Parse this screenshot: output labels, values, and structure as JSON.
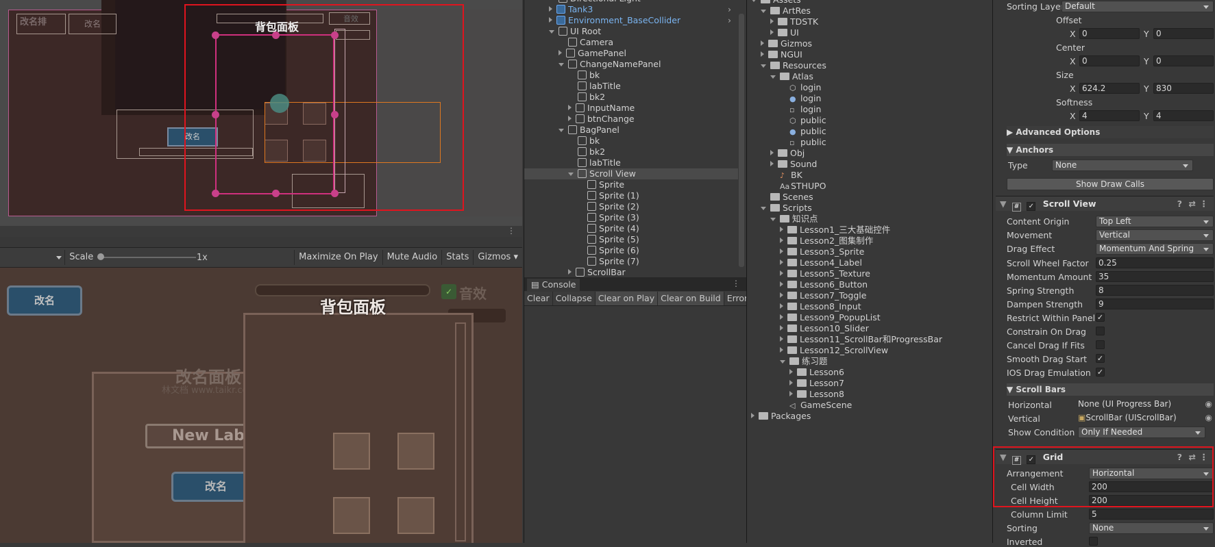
{
  "scene": {
    "title_label": "背包面板",
    "btn_rename_small": "改名",
    "top_left_label": "改名排",
    "top_btn": "改名",
    "top_right_label": "音效"
  },
  "game_toolbar": {
    "scale_label": "Scale",
    "scale_value": "1x",
    "maximize": "Maximize On Play",
    "mute": "Mute Audio",
    "stats": "Stats",
    "gizmos": "Gizmos"
  },
  "game": {
    "rename_btn": "改名",
    "bag_title": "背包面板",
    "sound_label": "音效",
    "rename_panel_title": "改名面板",
    "watermark": "林文档 www.taikr.com",
    "new_label": "New Label",
    "rename_btn2": "改名"
  },
  "hierarchy": {
    "items": [
      {
        "label": "Directional Light",
        "indent": 1
      },
      {
        "label": "Tank3",
        "indent": 1,
        "prefab": true
      },
      {
        "label": "Environment_BaseCollider",
        "indent": 1,
        "prefab": true
      },
      {
        "label": "UI Root",
        "indent": 1
      },
      {
        "label": "Camera",
        "indent": 2
      },
      {
        "label": "GamePanel",
        "indent": 2
      },
      {
        "label": "ChangeNamePanel",
        "indent": 2
      },
      {
        "label": "bk",
        "indent": 3
      },
      {
        "label": "labTitle",
        "indent": 3
      },
      {
        "label": "bk2",
        "indent": 3
      },
      {
        "label": "InputName",
        "indent": 3
      },
      {
        "label": "btnChange",
        "indent": 3
      },
      {
        "label": "BagPanel",
        "indent": 2
      },
      {
        "label": "bk",
        "indent": 3
      },
      {
        "label": "bk2",
        "indent": 3
      },
      {
        "label": "labTitle",
        "indent": 3
      },
      {
        "label": "Scroll View",
        "indent": 3
      },
      {
        "label": "Sprite",
        "indent": 4
      },
      {
        "label": "Sprite (1)",
        "indent": 4
      },
      {
        "label": "Sprite (2)",
        "indent": 4
      },
      {
        "label": "Sprite (3)",
        "indent": 4
      },
      {
        "label": "Sprite (4)",
        "indent": 4
      },
      {
        "label": "Sprite (5)",
        "indent": 4
      },
      {
        "label": "Sprite (6)",
        "indent": 4
      },
      {
        "label": "Sprite (7)",
        "indent": 4
      },
      {
        "label": "ScrollBar",
        "indent": 3
      }
    ]
  },
  "console": {
    "tab": "Console",
    "buttons": [
      "Clear",
      "Collapse",
      "Clear on Play",
      "Clear on Build",
      "Error Pau"
    ]
  },
  "project": {
    "items": [
      {
        "label": "Assets",
        "indent": 0
      },
      {
        "label": "ArtRes",
        "indent": 1
      },
      {
        "label": "TDSTK",
        "indent": 2
      },
      {
        "label": "UI",
        "indent": 2
      },
      {
        "label": "Gizmos",
        "indent": 1
      },
      {
        "label": "NGUI",
        "indent": 1
      },
      {
        "label": "Resources",
        "indent": 1
      },
      {
        "label": "Atlas",
        "indent": 2
      },
      {
        "label": "login",
        "indent": 3
      },
      {
        "label": "login",
        "indent": 3
      },
      {
        "label": "login",
        "indent": 3
      },
      {
        "label": "public",
        "indent": 3
      },
      {
        "label": "public",
        "indent": 3
      },
      {
        "label": "public",
        "indent": 3
      },
      {
        "label": "Obj",
        "indent": 2
      },
      {
        "label": "Sound",
        "indent": 2
      },
      {
        "label": "BK",
        "indent": 2
      },
      {
        "label": "STHUPO",
        "indent": 2
      },
      {
        "label": "Scenes",
        "indent": 1
      },
      {
        "label": "Scripts",
        "indent": 1
      },
      {
        "label": "知识点",
        "indent": 2
      },
      {
        "label": "Lesson1_三大基础控件",
        "indent": 3
      },
      {
        "label": "Lesson2_图集制作",
        "indent": 3
      },
      {
        "label": "Lesson3_Sprite",
        "indent": 3
      },
      {
        "label": "Lesson4_Label",
        "indent": 3
      },
      {
        "label": "Lesson5_Texture",
        "indent": 3
      },
      {
        "label": "Lesson6_Button",
        "indent": 3
      },
      {
        "label": "Lesson7_Toggle",
        "indent": 3
      },
      {
        "label": "Lesson8_Input",
        "indent": 3
      },
      {
        "label": "Lesson9_PopupList",
        "indent": 3
      },
      {
        "label": "Lesson10_Slider",
        "indent": 3
      },
      {
        "label": "Lesson11_ScrollBar和ProgressBar",
        "indent": 3
      },
      {
        "label": "Lesson12_ScrollView",
        "indent": 3
      },
      {
        "label": "练习题",
        "indent": 3
      },
      {
        "label": "Lesson6",
        "indent": 4
      },
      {
        "label": "Lesson7",
        "indent": 4
      },
      {
        "label": "Lesson8",
        "indent": 4
      },
      {
        "label": "GameScene",
        "indent": 3
      },
      {
        "label": "Packages",
        "indent": 0
      }
    ]
  },
  "inspector": {
    "sorting_layer_label": "Sorting Layer",
    "sorting_layer_value": "Default",
    "offset_label": "Offset",
    "offset_x": "0",
    "offset_y": "0",
    "center_label": "Center",
    "center_x": "0",
    "center_y": "0",
    "size_label": "Size",
    "size_x": "624.2",
    "size_y": "830",
    "softness_label": "Softness",
    "softness_x": "4",
    "softness_y": "4",
    "x": "X",
    "y": "Y",
    "advanced_options": "Advanced Options",
    "anchors": "Anchors",
    "type_label": "Type",
    "type_value": "None",
    "show_draw_calls": "Show Draw Calls",
    "scroll_view": {
      "title": "Scroll View",
      "content_origin_label": "Content Origin",
      "content_origin": "Top Left",
      "movement_label": "Movement",
      "movement": "Vertical",
      "drag_effect_label": "Drag Effect",
      "drag_effect": "Momentum And Spring",
      "scroll_wheel_label": "Scroll Wheel Factor",
      "scroll_wheel": "0.25",
      "momentum_label": "Momentum Amount",
      "momentum": "35",
      "spring_label": "Spring Strength",
      "spring": "8",
      "dampen_label": "Dampen Strength",
      "dampen": "9",
      "restrict_label": "Restrict Within Panel",
      "constrain_label": "Constrain On Drag",
      "cancel_label": "Cancel Drag If Fits",
      "smooth_label": "Smooth Drag Start",
      "ios_label": "IOS Drag Emulation",
      "scroll_bars": "Scroll Bars",
      "horizontal_label": "Horizontal",
      "horizontal": "None (UI Progress Bar)",
      "vertical_label": "Vertical",
      "vertical": "ScrollBar (UIScrollBar)",
      "show_condition_label": "Show Condition",
      "show_condition": "Only If Needed"
    },
    "grid": {
      "title": "Grid",
      "arrangement_label": "Arrangement",
      "arrangement": "Horizontal",
      "cell_width_label": "Cell Width",
      "cell_width": "200",
      "cell_height_label": "Cell Height",
      "cell_height": "200",
      "column_limit_label": "Column Limit",
      "column_limit": "5",
      "sorting_label": "Sorting",
      "sorting": "None",
      "inverted_label": "Inverted"
    }
  }
}
